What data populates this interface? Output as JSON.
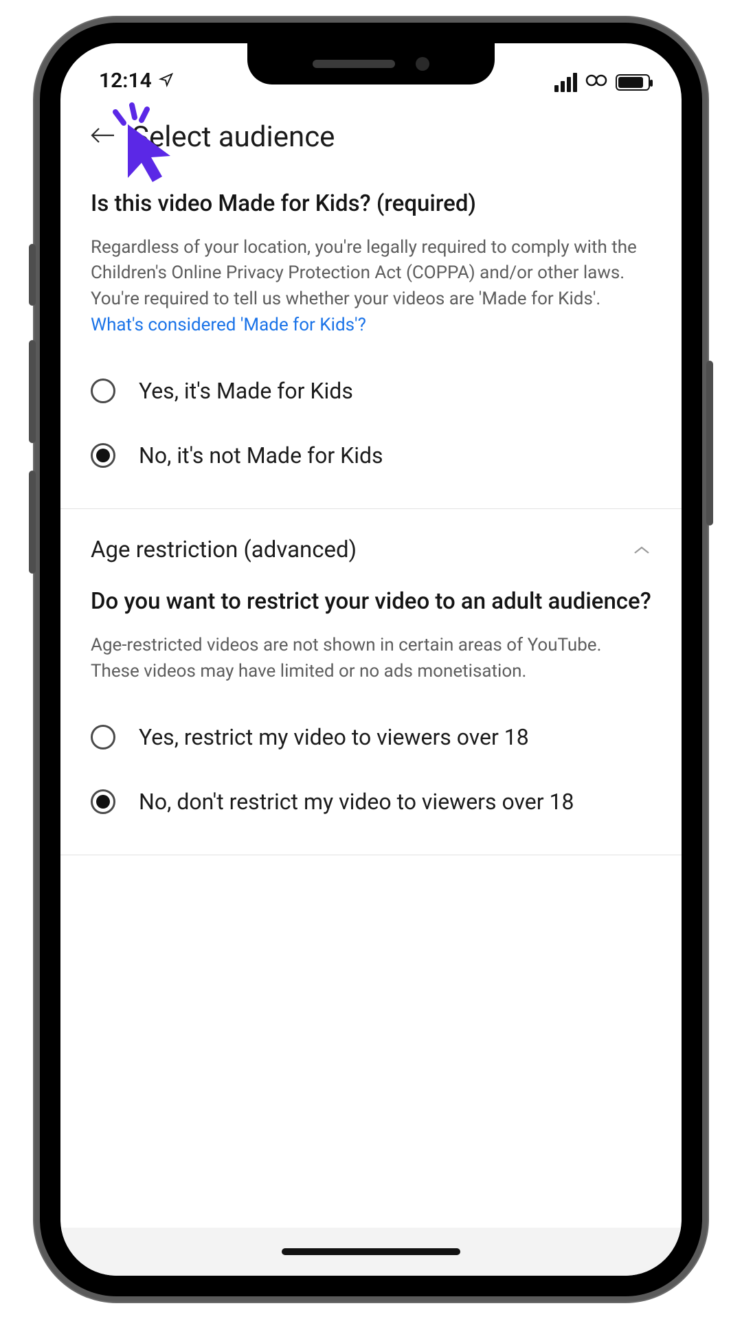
{
  "status": {
    "time": "12:14"
  },
  "header": {
    "title": "Select audience"
  },
  "made_for_kids": {
    "question": "Is this video Made for Kids? (required)",
    "helper_pre": "Regardless of your location, you're legally required to comply with the Children's Online Privacy Protection Act (COPPA) and/or other laws. You're required to tell us whether your videos are 'Made for Kids'. ",
    "helper_link": "What's considered 'Made for Kids'?",
    "option_yes": "Yes, it's Made for Kids",
    "option_no": "No, it's not Made for Kids",
    "selected": "no"
  },
  "age_section": {
    "title": "Age restriction (advanced)",
    "question": "Do you want to restrict your video to an adult audience?",
    "helper": "Age-restricted videos are not shown in certain areas of YouTube. These videos may have limited or no ads monetisation.",
    "option_yes": "Yes, restrict my video to viewers over 18",
    "option_no": "No, don't restrict my video to viewers over 18",
    "selected": "no",
    "expanded": true
  },
  "colors": {
    "cursor": "#5b28e6",
    "link": "#1a73e8"
  }
}
